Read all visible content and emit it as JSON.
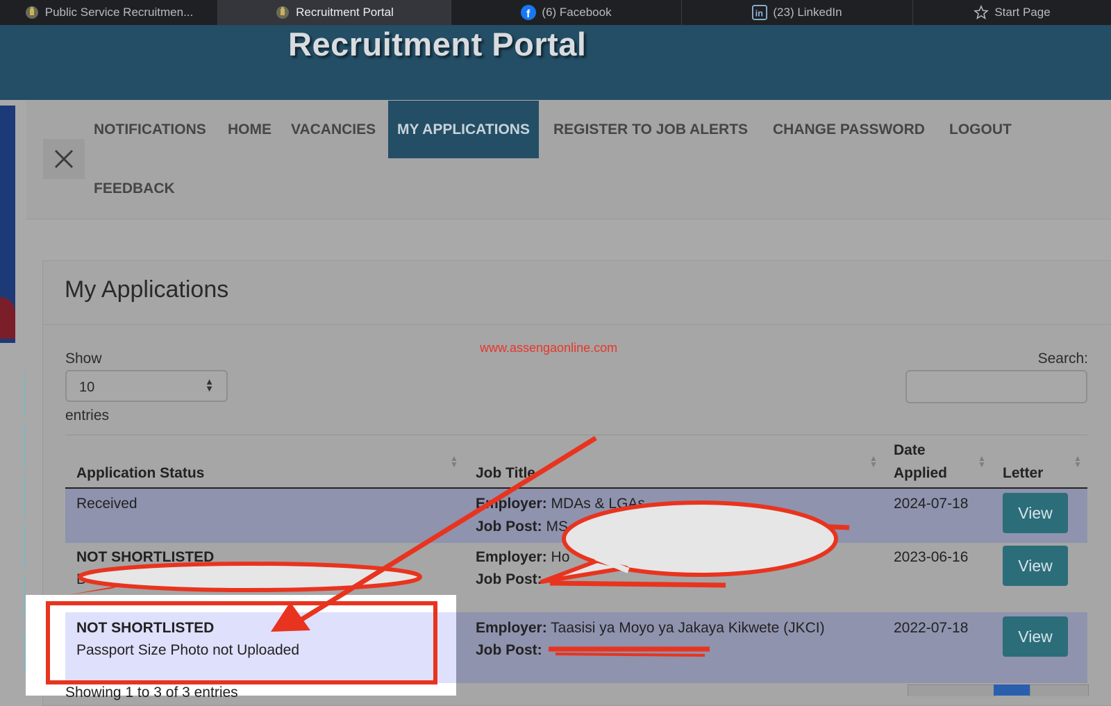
{
  "browser": {
    "tabs": [
      {
        "label": "Public Service Recruitmen...",
        "icon": "coat-of-arms-icon"
      },
      {
        "label": "Recruitment Portal",
        "icon": "coat-of-arms-icon"
      },
      {
        "label": "(6) Facebook",
        "icon": "facebook-icon"
      },
      {
        "label": "(23) LinkedIn",
        "icon": "linkedin-icon"
      },
      {
        "label": "Start Page",
        "icon": "star-icon"
      }
    ],
    "active_tab_index": 1
  },
  "header": {
    "title": "Recruitment Portal"
  },
  "nav": {
    "items": [
      "NOTIFICATIONS",
      "HOME",
      "VACANCIES",
      "MY APPLICATIONS",
      "REGISTER TO JOB ALERTS",
      "CHANGE PASSWORD",
      "LOGOUT",
      "FEEDBACK"
    ],
    "active": "MY APPLICATIONS",
    "close_icon": "close-icon"
  },
  "page": {
    "heading": "My Applications",
    "watermark": "www.assengaonline.com",
    "show_label": "Show",
    "entries_value": "10",
    "entries_label": "entries",
    "search_label": "Search:",
    "search_value": ""
  },
  "table": {
    "headers": {
      "status": "Application Status",
      "job_title": "Job Title",
      "date_line1": "Date",
      "date_line2": "Applied",
      "letter": "Letter"
    },
    "rows": [
      {
        "status_title": "Received",
        "status_detail": "",
        "employer_label": "Employer:",
        "employer": "MDAs & LGAs",
        "jobpost_label": "Job Post:",
        "jobpost": "MS",
        "date": "2024-07-18",
        "letter_button": "View"
      },
      {
        "status_title": "NOT SHORTLISTED",
        "status_detail": "B",
        "employer_label": "Employer:",
        "employer": "Ho",
        "jobpost_label": "Job Post:",
        "jobpost": "",
        "date": "2023-06-16",
        "letter_button": "View"
      },
      {
        "status_title": "NOT SHORTLISTED",
        "status_detail": "Passport Size Photo not Uploaded",
        "employer_label": "Employer:",
        "employer": "Taasisi ya Moyo ya Jakaya Kikwete (JKCI)",
        "jobpost_label": "Job Post:",
        "jobpost": "",
        "date": "2022-07-18",
        "letter_button": "View"
      }
    ],
    "footer_info": "Showing 1 to 3 of 3 entries"
  },
  "annotation_colors": {
    "red": "#e8341f",
    "highlight": "#dfe0fb"
  }
}
